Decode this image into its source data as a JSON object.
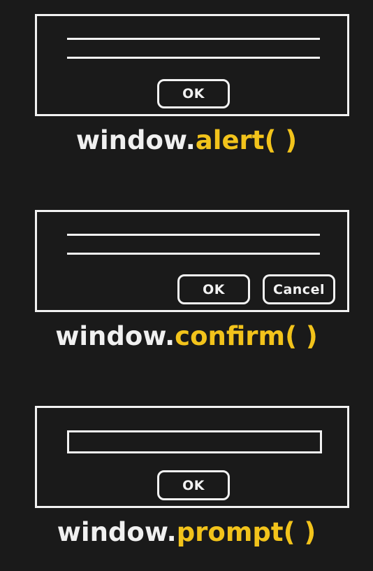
{
  "colors": {
    "background": "#1a1a1a",
    "outline": "#f2f2f2",
    "caption_object": "#f0f0f0",
    "caption_method": "#f2c31b"
  },
  "alert": {
    "ok_label": "OK",
    "caption_object": "window.",
    "caption_method": "alert( )"
  },
  "confirm": {
    "ok_label": "OK",
    "cancel_label": "Cancel",
    "caption_object": "window.",
    "caption_method": "confirm( )"
  },
  "prompt": {
    "ok_label": "OK",
    "caption_object": "window.",
    "caption_method": "prompt( )"
  }
}
